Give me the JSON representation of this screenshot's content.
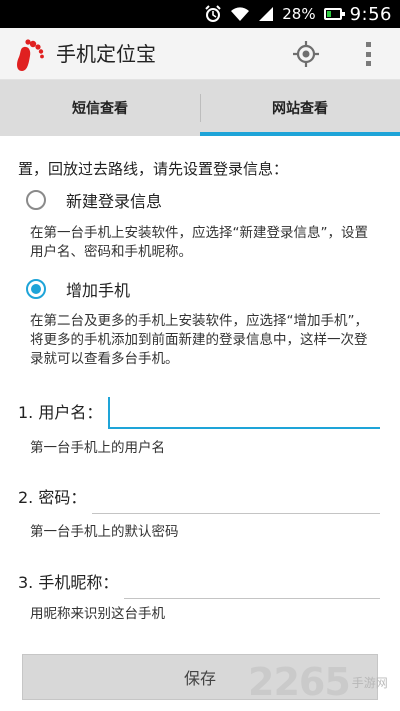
{
  "status_bar": {
    "battery_percent": "28%",
    "time": "9:56",
    "icons": [
      "alarm-icon",
      "wifi-icon",
      "signal-icon",
      "battery-icon"
    ]
  },
  "action_bar": {
    "title": "手机定位宝",
    "logo_icon": "footprint-icon",
    "actions": [
      "locate-icon",
      "overflow-menu-icon"
    ]
  },
  "tabs": [
    {
      "label": "短信查看",
      "active": false
    },
    {
      "label": "网站查看",
      "active": true
    }
  ],
  "intro_text": "置，回放过去路线，请先设置登录信息：",
  "options": [
    {
      "label": "新建登录信息",
      "checked": false,
      "description": "在第一台手机上安装软件，应选择“新建登录信息”，设置用户名、密码和手机昵称。"
    },
    {
      "label": "增加手机",
      "checked": true,
      "description": "在第二台及更多的手机上安装软件，应选择“增加手机”，将更多的手机添加到前面新建的登录信息中，这样一次登录就可以查看多台手机。"
    }
  ],
  "fields": [
    {
      "label": "1. 用户名：",
      "value": "",
      "hint": "第一台手机上的用户名"
    },
    {
      "label": "2. 密码：",
      "value": "",
      "hint": "第一台手机上的默认密码"
    },
    {
      "label": "3. 手机昵称：",
      "value": "",
      "hint": "用昵称来识别这台手机"
    }
  ],
  "save_label": "保存",
  "watermark": {
    "number": "2265",
    "sub": "手游网"
  },
  "colors": {
    "accent": "#1ea4d8",
    "logo_red": "#e02020"
  }
}
